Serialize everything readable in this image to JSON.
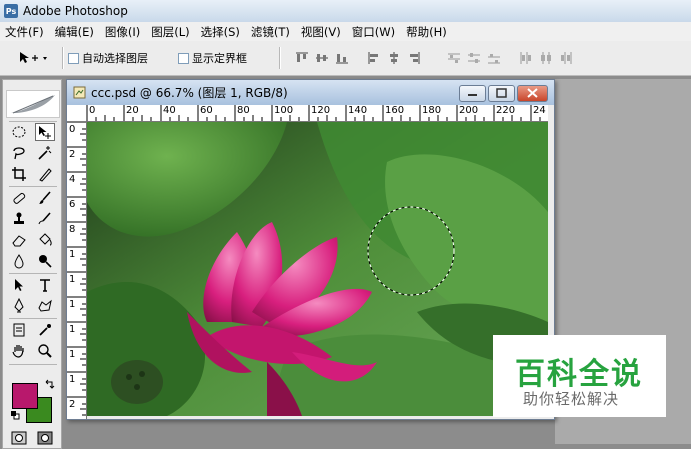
{
  "app": {
    "title": "Adobe Photoshop",
    "logo_text": "Ps"
  },
  "menu": [
    {
      "label": "文件(F)"
    },
    {
      "label": "编辑(E)"
    },
    {
      "label": "图像(I)"
    },
    {
      "label": "图层(L)"
    },
    {
      "label": "选择(S)"
    },
    {
      "label": "滤镜(T)"
    },
    {
      "label": "视图(V)"
    },
    {
      "label": "窗口(W)"
    },
    {
      "label": "帮助(H)"
    }
  ],
  "options": {
    "auto_select_label": "自动选择图层",
    "show_bounds_label": "显示定界框",
    "auto_select_checked": false,
    "show_bounds_checked": false
  },
  "document": {
    "title": "ccc.psd @ 66.7% (图层 1, RGB/8)",
    "ruler_top_ticks": [
      "0",
      "20",
      "40",
      "60",
      "80",
      "100",
      "120",
      "140",
      "160",
      "180",
      "200",
      "220",
      "24"
    ],
    "ruler_left_ticks": [
      "0",
      "2",
      "4",
      "6",
      "8",
      "1",
      "1",
      "1",
      "1",
      "1",
      "1",
      "2"
    ]
  },
  "colors": {
    "foreground": "#b8186c",
    "background": "#3a8a1f",
    "selection": "#ffffff"
  },
  "watermark": {
    "title": "百科全说",
    "subtitle": "助你轻松解决",
    "title_color": "#27a33f"
  }
}
